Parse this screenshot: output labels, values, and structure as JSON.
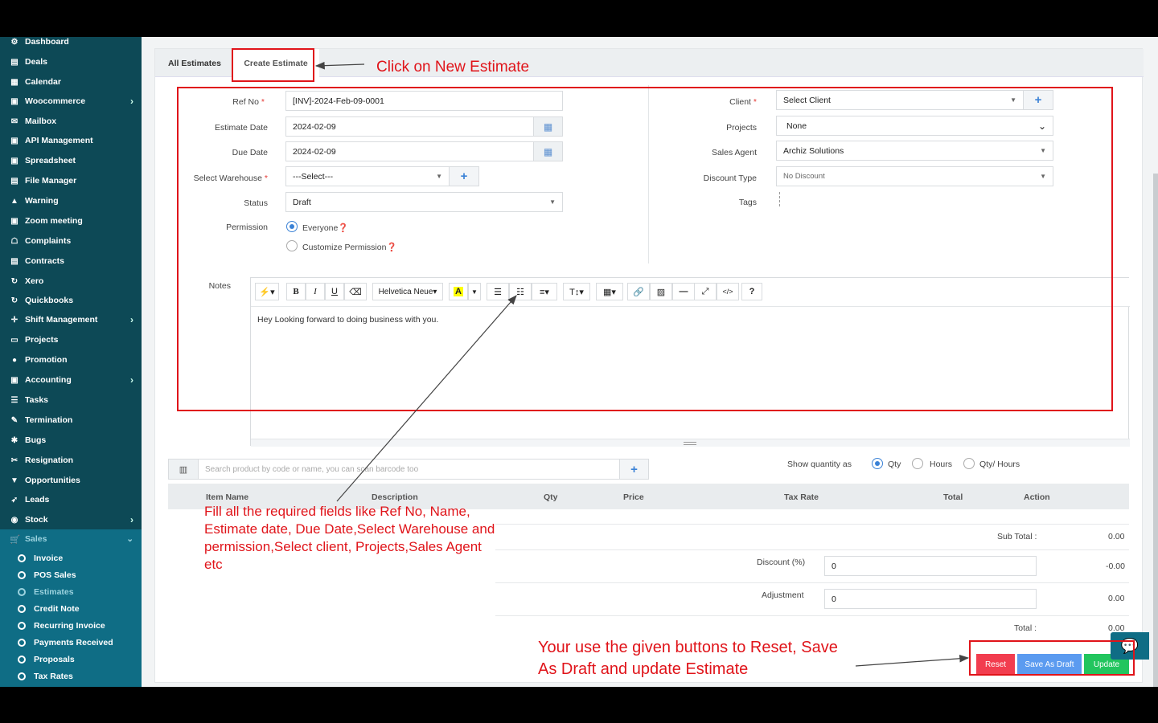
{
  "sidebar": {
    "items": [
      {
        "icon": "⚙",
        "label": "Dashboard",
        "chev": false
      },
      {
        "icon": "▤",
        "label": "Deals",
        "chev": false
      },
      {
        "icon": "▦",
        "label": "Calendar",
        "chev": false
      },
      {
        "icon": "▣",
        "label": "Woocommerce",
        "chev": true
      },
      {
        "icon": "✉",
        "label": "Mailbox",
        "chev": false
      },
      {
        "icon": "▣",
        "label": "API Management",
        "chev": false
      },
      {
        "icon": "▣",
        "label": "Spreadsheet",
        "chev": false
      },
      {
        "icon": "▤",
        "label": "File Manager",
        "chev": false
      },
      {
        "icon": "▲",
        "label": "Warning",
        "chev": false
      },
      {
        "icon": "▣",
        "label": "Zoom meeting",
        "chev": false
      },
      {
        "icon": "☖",
        "label": "Complaints",
        "chev": false
      },
      {
        "icon": "▤",
        "label": "Contracts",
        "chev": false
      },
      {
        "icon": "↻",
        "label": "Xero",
        "chev": false
      },
      {
        "icon": "↻",
        "label": "Quickbooks",
        "chev": false
      },
      {
        "icon": "✛",
        "label": "Shift Management",
        "chev": true
      },
      {
        "icon": "▭",
        "label": "Projects",
        "chev": false
      },
      {
        "icon": "●",
        "label": "Promotion",
        "chev": false
      },
      {
        "icon": "▣",
        "label": "Accounting",
        "chev": true
      },
      {
        "icon": "☰",
        "label": "Tasks",
        "chev": false
      },
      {
        "icon": "✎",
        "label": "Termination",
        "chev": false
      },
      {
        "icon": "✱",
        "label": "Bugs",
        "chev": false
      },
      {
        "icon": "✂",
        "label": "Resignation",
        "chev": false
      },
      {
        "icon": "▼",
        "label": "Opportunities",
        "chev": false
      },
      {
        "icon": "➶",
        "label": "Leads",
        "chev": false
      },
      {
        "icon": "◉",
        "label": "Stock",
        "chev": true
      }
    ],
    "sales_label": "Sales",
    "sales_items": [
      "Invoice",
      "POS Sales",
      "Estimates",
      "Credit Note",
      "Recurring Invoice",
      "Payments Received",
      "Proposals",
      "Tax Rates"
    ]
  },
  "tabs": {
    "all": "All Estimates",
    "create": "Create Estimate"
  },
  "form": {
    "ref_label": "Ref No",
    "ref_value": "[INV]-2024-Feb-09-0001",
    "est_date_label": "Estimate Date",
    "est_date_value": "2024-02-09",
    "due_date_label": "Due Date",
    "due_date_value": "2024-02-09",
    "warehouse_label": "Select Warehouse",
    "warehouse_value": "---Select---",
    "status_label": "Status",
    "status_value": "Draft",
    "permission_label": "Permission",
    "perm_everyone": "Everyone",
    "perm_custom": "Customize Permission",
    "client_label": "Client",
    "client_value": "Select Client",
    "projects_label": "Projects",
    "projects_value": "None",
    "agent_label": "Sales Agent",
    "agent_value": "Archiz Solutions",
    "discount_type_label": "Discount Type",
    "discount_type_value": "No Discount",
    "tags_label": "Tags",
    "notes_label": "Notes",
    "notes_text": "Hey Looking forward to doing business with you.",
    "font_name": "Helvetica Neue"
  },
  "items": {
    "search_placeholder": "Search product by code or name, you can scan barcode too",
    "show_qty_label": "Show quantity as",
    "qty_opts": [
      "Qty",
      "Hours",
      "Qty/ Hours"
    ],
    "columns": [
      "Item Name",
      "Description",
      "Qty",
      "Price",
      "Tax Rate",
      "Total",
      "Action"
    ]
  },
  "totals": {
    "subtotal_label": "Sub Total :",
    "subtotal_value": "0.00",
    "discount_label": "Discount (%)",
    "discount_input": "0",
    "discount_value": "-0.00",
    "adjustment_label": "Adjustment",
    "adjustment_input": "0",
    "adjustment_value": "0.00",
    "total_label": "Total :",
    "total_value": "0.00"
  },
  "buttons": {
    "reset": "Reset",
    "draft": "Save As Draft",
    "update": "Update"
  },
  "colors": {
    "sidebar": "#0d4956",
    "sales": "#0f6d85",
    "reset": "#f23d4f",
    "draft": "#5b9bf0",
    "update": "#22c55e",
    "annotation": "#e0141a"
  },
  "annotations": {
    "a1": "Click on  New Estimate",
    "a2_lines": [
      "Fill all the required fields like  Ref No, Name,",
      "Estimate date, Due Date,Select Warehouse and",
      "permission,Select client, Projects,Sales Agent",
      "etc"
    ],
    "a3_lines": [
      "Your use the given buttons to  Reset, Save",
      "As Draft  and update Estimate"
    ]
  }
}
